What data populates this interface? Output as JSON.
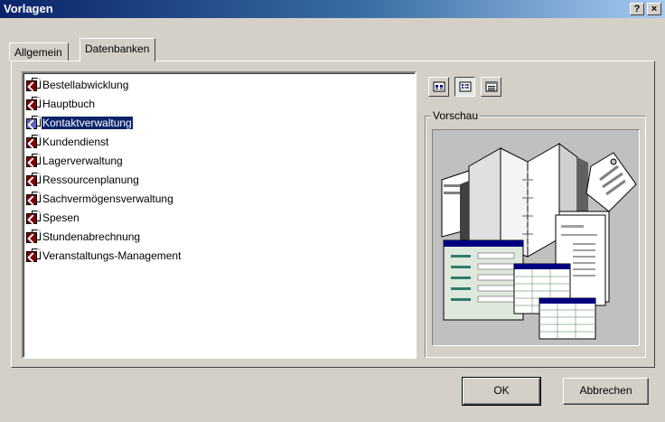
{
  "window": {
    "title": "Vorlagen",
    "help_label": "?",
    "close_label": "×"
  },
  "tabs": [
    {
      "label": "Allgemein",
      "active": false
    },
    {
      "label": "Datenbanken",
      "active": true
    }
  ],
  "templates": [
    {
      "label": "Bestellabwicklung",
      "selected": false
    },
    {
      "label": "Hauptbuch",
      "selected": false
    },
    {
      "label": "Kontaktverwaltung",
      "selected": true
    },
    {
      "label": "Kundendienst",
      "selected": false
    },
    {
      "label": "Lagerverwaltung",
      "selected": false
    },
    {
      "label": "Ressourcenplanung",
      "selected": false
    },
    {
      "label": "Sachvermögensverwaltung",
      "selected": false
    },
    {
      "label": "Spesen",
      "selected": false
    },
    {
      "label": "Stundenabrechnung",
      "selected": false
    },
    {
      "label": "Veranstaltungs-Management",
      "selected": false
    }
  ],
  "view_buttons": [
    {
      "icon": "large-icons-icon",
      "pressed": false
    },
    {
      "icon": "list-view-icon",
      "pressed": true
    },
    {
      "icon": "details-view-icon",
      "pressed": false
    }
  ],
  "preview": {
    "label": "Vorschau"
  },
  "buttons": {
    "ok_label": "OK",
    "cancel_label": "Abbrechen"
  },
  "colors": {
    "title_bar": "#0a246a",
    "face": "#d4d0c8",
    "selection": "#0a246a",
    "preview_bg": "#c0c0c0"
  }
}
